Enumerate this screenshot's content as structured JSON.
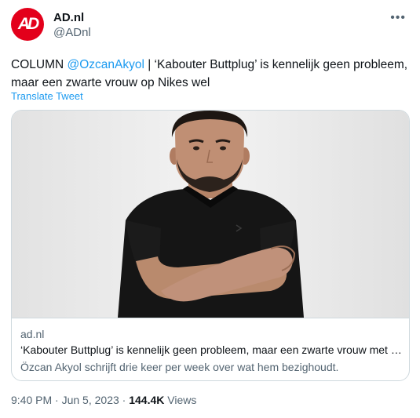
{
  "author": {
    "logo_text": "AD",
    "name": "AD.nl",
    "handle": "@ADnl",
    "brand_color": "#e3001b"
  },
  "more_icon": "more-horizontal-icon",
  "tweet": {
    "prefix": "COLUMN ",
    "mention": "@OzcanAkyol",
    "text": " | ‘Kabouter Buttplug’ is kennelijk geen probleem, maar een zwarte vrouw op Nikes wel",
    "translate_label": "Translate Tweet"
  },
  "card": {
    "domain": "ad.nl",
    "title": "‘Kabouter Buttplug’ is kennelijk geen probleem, maar een zwarte vrouw met Nikes wel",
    "description": "Özcan Akyol schrijft drie keer per week over wat hem bezighoudt."
  },
  "meta": {
    "time": "9:40 PM",
    "separator": " · ",
    "date": "Jun 5, 2023",
    "views_count": "144.4K",
    "views_label": " Views"
  },
  "colors": {
    "link": "#1d9bf0",
    "secondary_text": "#536471",
    "border": "#cfd9de"
  }
}
